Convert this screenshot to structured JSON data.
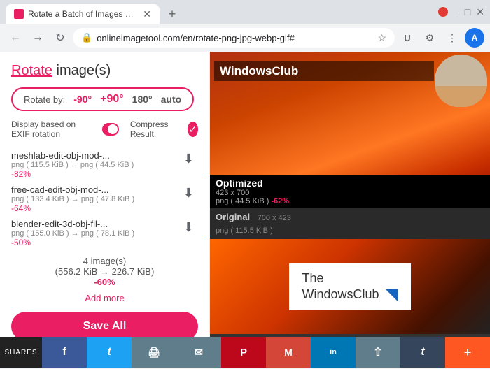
{
  "browser": {
    "tab_title": "Rotate a Batch of Images Online",
    "url": "onlineimagetool.com/en/rotate-png-jpg-webp-gif#",
    "new_tab_label": "+"
  },
  "toolbar": {
    "back_icon": "←",
    "forward_icon": "→",
    "refresh_icon": "↻",
    "lock_icon": "🔒",
    "star_icon": "☆",
    "extensions_icon": "U",
    "profile_label": "A"
  },
  "page": {
    "title_rotate": "Rotate",
    "title_rest": " image(s)",
    "rotate_by_label": "Rotate by:",
    "rotate_options": [
      "-90°",
      "+90°",
      "180°",
      "auto"
    ],
    "display_exif_label": "Display based on EXIF rotation",
    "compress_label": "Compress Result:",
    "files": [
      {
        "name": "meshlab-edit-obj-mod-...",
        "size_from": "png ( 115.5 KiB )",
        "size_to": "png ( 44.5 KiB )",
        "reduction": "-82%"
      },
      {
        "name": "free-cad-edit-obj-mod-...",
        "size_from": "png ( 133.4 KiB )",
        "size_to": "png ( 47.8 KiB )",
        "reduction": "-64%"
      },
      {
        "name": "blender-edit-3d-obj-fil-...",
        "size_from": "png ( 155.0 KiB )",
        "size_to": "png ( 78.1 KiB )",
        "reduction": "-50%"
      }
    ],
    "summary_count": "4 image(s)",
    "summary_size": "(556.2 KiB → 226.7 KiB)",
    "summary_reduction": "-60%",
    "add_more_label": "Add more",
    "save_all_label": "Save All"
  },
  "right_panel": {
    "banner_text": "WindowsClub",
    "optimized_label": "Optimized",
    "optimized_dims": "423 x 700",
    "optimized_type": "png ( 44.5 KiB )",
    "optimized_reduction": "-62%",
    "original_label": "Original",
    "original_dims": "700 x 423",
    "original_type": "png ( 115.5 KiB )",
    "wc_logo_line1": "The",
    "wc_logo_line2": "WindowsClub"
  },
  "shares_bar": {
    "label": "SHARES",
    "buttons": [
      {
        "id": "facebook",
        "symbol": "f",
        "class": "facebook"
      },
      {
        "id": "twitter",
        "symbol": "t",
        "class": "twitter"
      },
      {
        "id": "print",
        "symbol": "🖨",
        "class": "print"
      },
      {
        "id": "email",
        "symbol": "✉",
        "class": "email"
      },
      {
        "id": "pinterest",
        "symbol": "P",
        "class": "pinterest"
      },
      {
        "id": "gmail",
        "symbol": "M",
        "class": "gmail"
      },
      {
        "id": "linkedin",
        "symbol": "in",
        "class": "linkedin"
      },
      {
        "id": "share2",
        "symbol": "⇧",
        "class": "share2"
      },
      {
        "id": "tumblr",
        "symbol": "t",
        "class": "tumblr"
      },
      {
        "id": "more",
        "symbol": "+",
        "class": "more"
      }
    ]
  }
}
